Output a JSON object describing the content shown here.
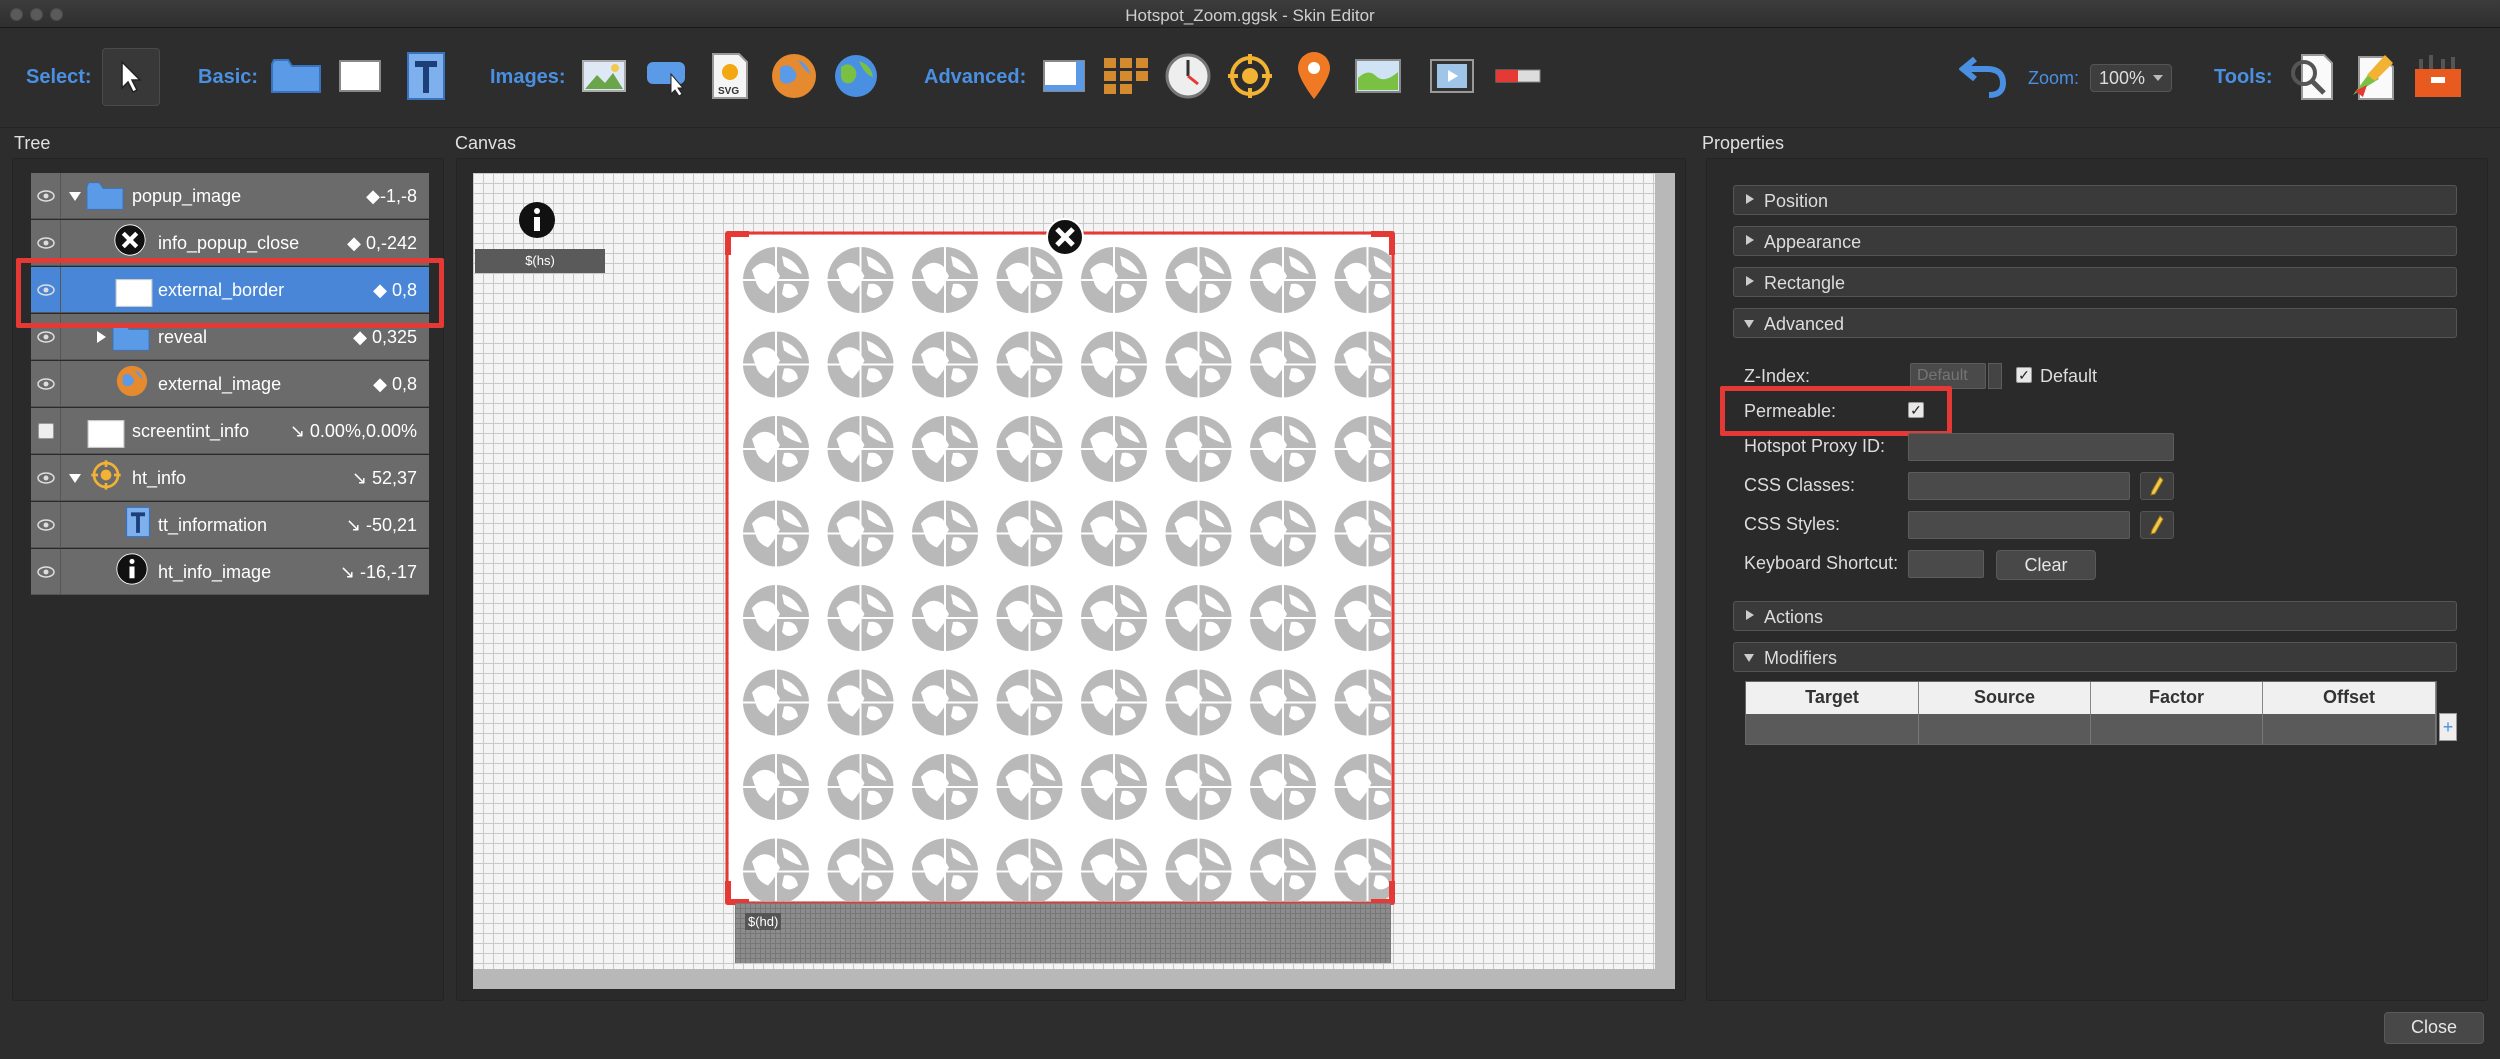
{
  "window": {
    "title": "Hotspot_Zoom.ggsk - Skin Editor"
  },
  "toolbar": {
    "select_label": "Select:",
    "basic_label": "Basic:",
    "images_label": "Images:",
    "advanced_label": "Advanced:",
    "zoom_label": "Zoom:",
    "zoom_value": "100%",
    "tools_label": "Tools:"
  },
  "tree": {
    "title": "Tree",
    "rows": [
      {
        "label": "popup_image",
        "coord": "◆-1,-8",
        "icon": "folder-icon",
        "expand": "down"
      },
      {
        "label": "info_popup_close",
        "coord": "◆ 0,-242",
        "icon": "close-circle-icon"
      },
      {
        "label": "external_border",
        "coord": "◆ 0,8",
        "icon": "rectangle-icon",
        "selected": true
      },
      {
        "label": "reveal",
        "coord": "◆ 0,325",
        "icon": "folder-icon",
        "expand": "right"
      },
      {
        "label": "external_image",
        "coord": "◆ 0,8",
        "icon": "globe-image-icon"
      },
      {
        "label": "screentint_info",
        "coord": "↘ 0.00%,0.00%",
        "icon": "rectangle-icon",
        "hidden": true
      },
      {
        "label": "ht_info",
        "coord": "↘ 52,37",
        "icon": "hotspot-icon",
        "expand": "down"
      },
      {
        "label": "tt_information",
        "coord": "↘ -50,21",
        "icon": "text-icon"
      },
      {
        "label": "ht_info_image",
        "coord": "↘ -16,-17",
        "icon": "info-circle-icon"
      }
    ]
  },
  "canvas": {
    "title": "Canvas",
    "hs_label": "$(hs)",
    "hd_label": "$(hd)"
  },
  "properties": {
    "title": "Properties",
    "sections": {
      "position": "Position",
      "appearance": "Appearance",
      "rectangle": "Rectangle",
      "advanced": "Advanced",
      "actions": "Actions",
      "modifiers": "Modifiers"
    },
    "z_index_label": "Z-Index:",
    "z_index_placeholder": "Default",
    "z_index_default_label": "Default",
    "permeable_label": "Permeable:",
    "proxy_label": "Hotspot Proxy ID:",
    "css_classes_label": "CSS Classes:",
    "css_styles_label": "CSS Styles:",
    "keyboard_label": "Keyboard Shortcut:",
    "clear_label": "Clear",
    "modifier_columns": [
      "Target",
      "Source",
      "Factor",
      "Offset"
    ]
  },
  "footer": {
    "close_label": "Close"
  },
  "colors": {
    "accent": "#4a90e2",
    "highlight": "#e53935",
    "selected_row": "#4a86d8"
  }
}
